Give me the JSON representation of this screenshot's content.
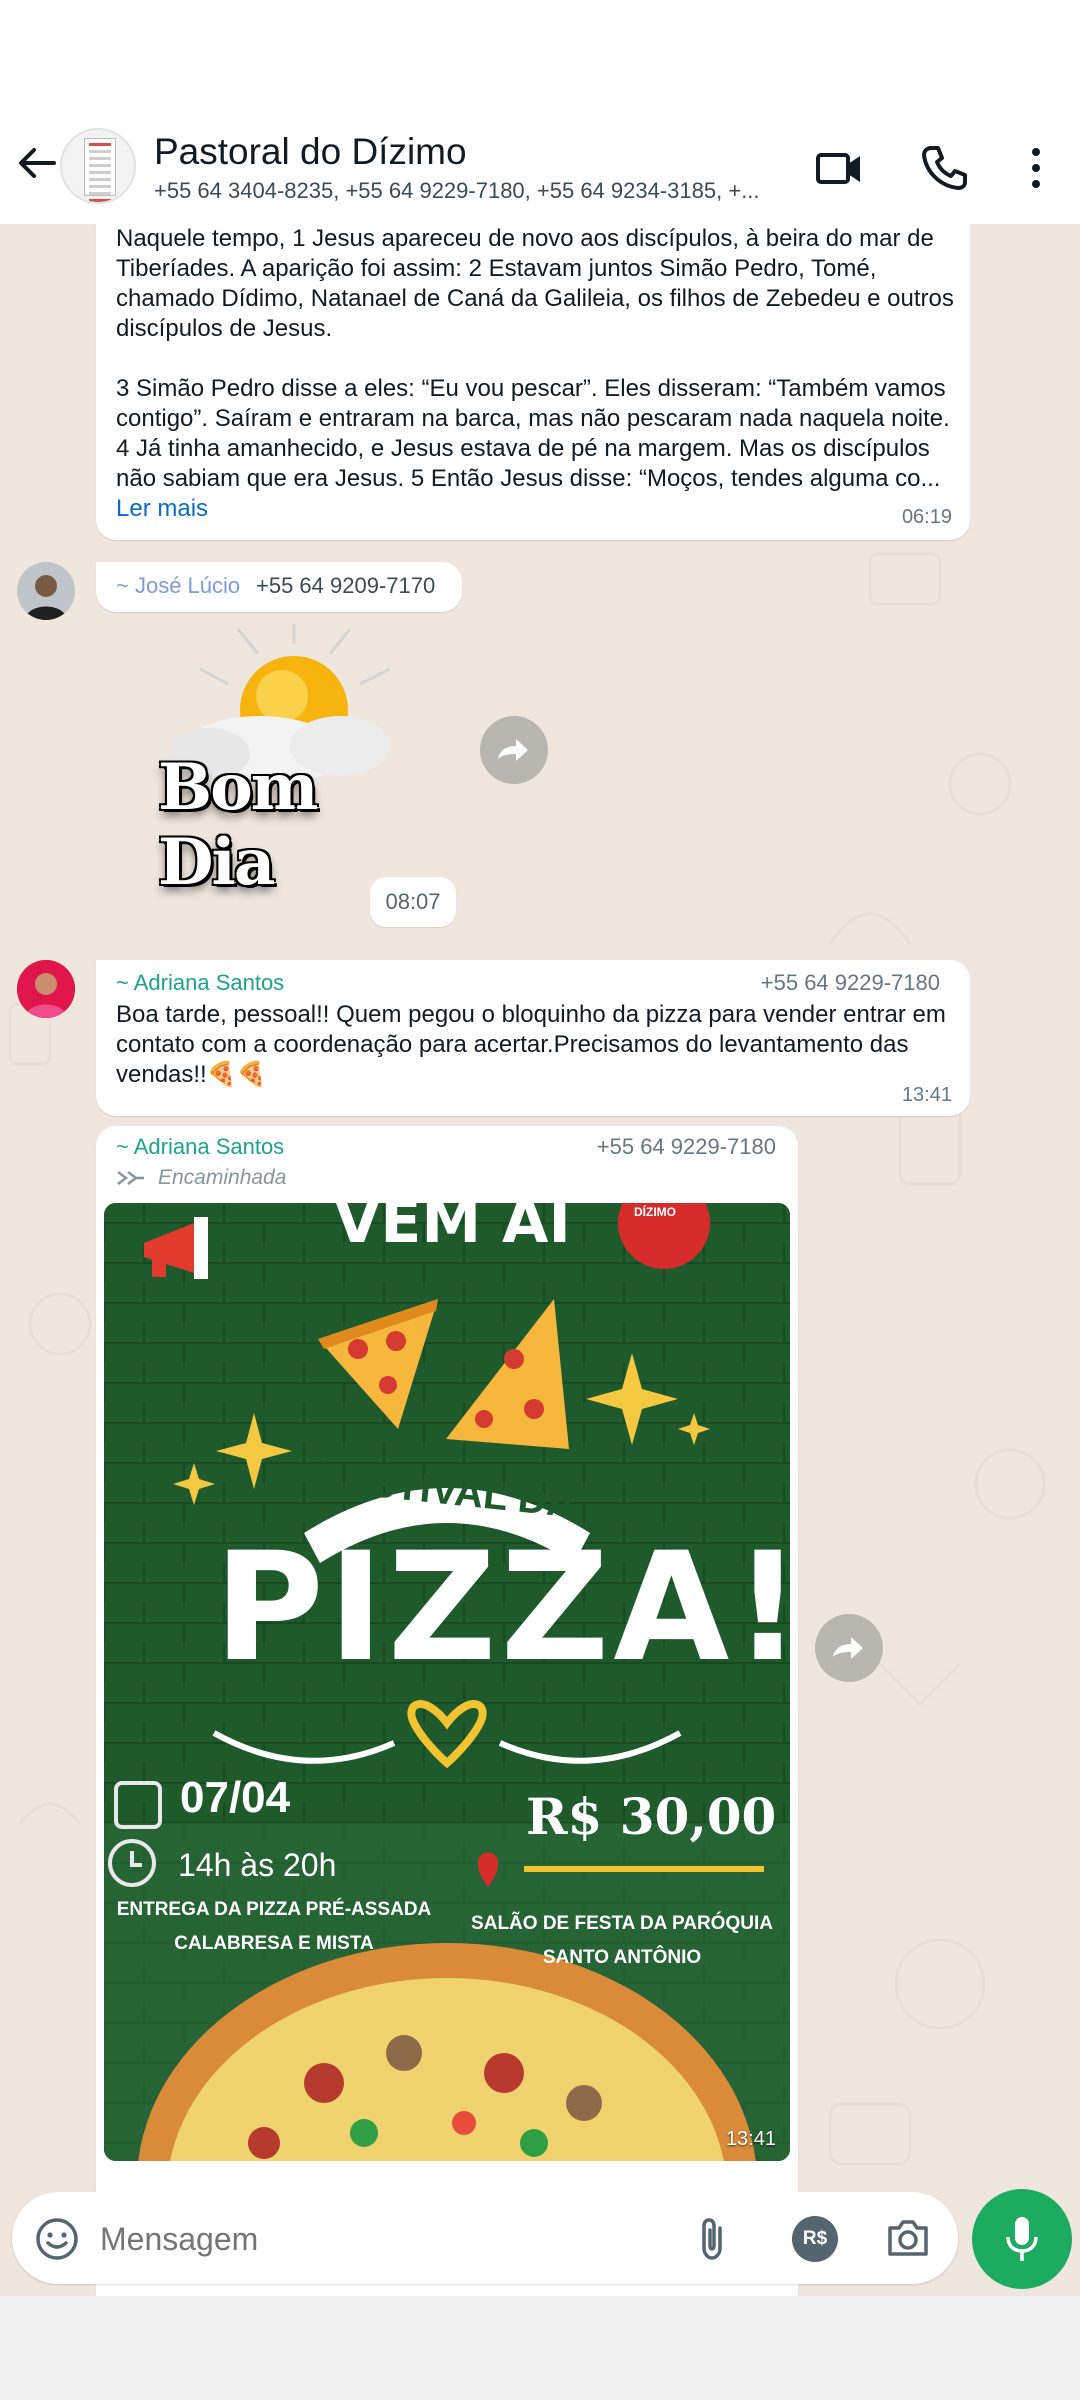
{
  "header": {
    "title": "Pastoral do Dízimo",
    "members": "+55 64 3404-8235, +55 64 9229-7180, +55 64 9234-3185, +..."
  },
  "messages": {
    "m1": {
      "text": "Naquele tempo, 1 Jesus apareceu de novo aos discípulos, à beira do mar de Tiberíades. A aparição foi assim: 2 Estavam juntos Simão Pedro, Tomé, chamado Dídimo, Natanael de Caná da Galileia, os filhos de Zebedeu e outros discípulos de Jesus.\n\n3 Simão Pedro disse a eles: “Eu vou pescar”. Eles disseram: “Também vamos contigo”. Saíram e entraram na barca, mas não pescaram nada naquela noite. 4 Já tinha amanhecido, e Jesus estava de pé na margem. Mas os discípulos não sabiam que era Jesus. 5 Então Jesus disse: “Moços, tendes alguma co... ",
      "read_more": "Ler mais",
      "time": "06:19"
    },
    "m2": {
      "sender": "~ José Lúcio",
      "phone": "+55 64 9209-7170",
      "sticker_text": "Bom Dia"
    },
    "date_chip": "08:07",
    "m3": {
      "sender": "~ Adriana Santos",
      "phone": "+55 64 9229-7180",
      "text": "Boa tarde, pessoal!! Quem pegou o bloquinho da pizza para vender entrar em contato com a coordenação para acertar.Precisamos do levantamento das vendas!!🍕🍕",
      "time": "13:41"
    },
    "m4": {
      "sender": "~ Adriana Santos",
      "phone": "+55 64 9229-7180",
      "forwarded": "Encaminhada",
      "time": "13:41",
      "poster": {
        "top_text": "VEM AÍ",
        "badge": "DÍZIMO",
        "festival": "FESTIVAL DA",
        "pizza": "PIZZA!",
        "date": "07/04",
        "hours": "14h às 20h",
        "price": "R$ 30,00",
        "delivery_1": "ENTREGA DA PIZZA PRÉ-ASSADA",
        "delivery_2": "CALABRESA E MISTA",
        "venue_1": "SALÃO DE FESTA DA PARÓQUIA",
        "venue_2": "SANTO ANTÔNIO"
      }
    }
  },
  "input": {
    "placeholder": "Mensagem",
    "currency_icon": "R$"
  },
  "colors": {
    "accent": "#1daa61",
    "sender": "#1da38a",
    "link": "#0b6bc7",
    "wallpaper": "#efe7de"
  }
}
